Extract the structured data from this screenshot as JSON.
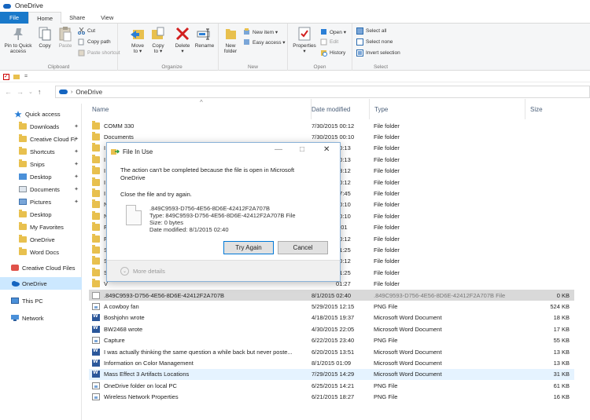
{
  "window": {
    "title": "OneDrive"
  },
  "tabs": [
    {
      "label": "File"
    },
    {
      "label": "Home"
    },
    {
      "label": "Share"
    },
    {
      "label": "View"
    }
  ],
  "ribbon": {
    "clipboard": {
      "label": "Clipboard",
      "pin": "Pin to Quick access",
      "pin_line1": "Pin to Quick",
      "pin_line2": "access",
      "copy": "Copy",
      "paste": "Paste",
      "cut": "Cut",
      "copy_path": "Copy path",
      "paste_shortcut": "Paste shortcut"
    },
    "organize": {
      "label": "Organize",
      "move_to": "Move",
      "move_to2": "to ▾",
      "copy_to": "Copy",
      "copy_to2": "to ▾",
      "delete": "Delete",
      "delete2": "▾",
      "rename": "Rename"
    },
    "new": {
      "label": "New",
      "new_folder1": "New",
      "new_folder2": "folder",
      "new_item": "New item ▾",
      "easy_access": "Easy access ▾"
    },
    "open": {
      "label": "Open",
      "properties": "Properties",
      "properties2": "▾",
      "open": "Open ▾",
      "edit": "Edit",
      "history": "History"
    },
    "select": {
      "label": "Select",
      "select_all": "Select all",
      "select_none": "Select none",
      "invert": "Invert selection"
    }
  },
  "qat": {
    "dropdown": "="
  },
  "address": {
    "back": "←",
    "forward": "→",
    "dropdown": "⌄",
    "up": "↑",
    "separator": "›",
    "path": "OneDrive"
  },
  "leftnav": {
    "items": [
      {
        "label": "Quick access",
        "pinned": false
      },
      {
        "label": "Downloads",
        "pinned": true
      },
      {
        "label": "Creative Cloud Fi",
        "pinned": true
      },
      {
        "label": "Shortcuts",
        "pinned": true
      },
      {
        "label": "Snips",
        "pinned": true
      },
      {
        "label": "Desktop",
        "pinned": true
      },
      {
        "label": "Documents",
        "pinned": true
      },
      {
        "label": "Pictures",
        "pinned": true
      },
      {
        "label": "Desktop",
        "pinned": false
      },
      {
        "label": "My Favorites",
        "pinned": false
      },
      {
        "label": "OneDrive",
        "pinned": false
      },
      {
        "label": "Word Docs",
        "pinned": false
      },
      {
        "label": "Creative Cloud Files",
        "pinned": false
      },
      {
        "label": "OneDrive",
        "pinned": false
      },
      {
        "label": "This PC",
        "pinned": false
      },
      {
        "label": "Network",
        "pinned": false
      }
    ],
    "pin_glyph": "✦"
  },
  "columns": {
    "name": "Name",
    "date": "Date modified",
    "type": "Type",
    "size": "Size",
    "sort_glyph": "^"
  },
  "files": [
    {
      "name": "COMM 330",
      "date": "7/30/2015 00:12",
      "type": "File folder",
      "size": "",
      "icon": "folder"
    },
    {
      "name": "Documents",
      "date": "7/30/2015 00:10",
      "type": "File folder",
      "size": "",
      "icon": "folder"
    },
    {
      "name": "I",
      "date": "00:13",
      "type": "File folder",
      "size": "",
      "icon": "folder"
    },
    {
      "name": "I",
      "date": "00:13",
      "type": "File folder",
      "size": "",
      "icon": "folder"
    },
    {
      "name": "I",
      "date": "03:12",
      "type": "File folder",
      "size": "",
      "icon": "folder"
    },
    {
      "name": "I",
      "date": "00:12",
      "type": "File folder",
      "size": "",
      "icon": "folder"
    },
    {
      "name": "I",
      "date": "17:45",
      "type": "File folder",
      "size": "",
      "icon": "folder"
    },
    {
      "name": "N",
      "date": "00:10",
      "type": "File folder",
      "size": "",
      "icon": "folder"
    },
    {
      "name": "N",
      "date": "00:10",
      "type": "File folder",
      "size": "",
      "icon": "folder"
    },
    {
      "name": "F",
      "date": "6:01",
      "type": "File folder",
      "size": "",
      "icon": "folder"
    },
    {
      "name": "F",
      "date": "00:12",
      "type": "File folder",
      "size": "",
      "icon": "folder"
    },
    {
      "name": "S",
      "date": "01:25",
      "type": "File folder",
      "size": "",
      "icon": "folder"
    },
    {
      "name": "S",
      "date": "00:12",
      "type": "File folder",
      "size": "",
      "icon": "folder"
    },
    {
      "name": "S",
      "date": "01:25",
      "type": "File folder",
      "size": "",
      "icon": "folder"
    },
    {
      "name": "V",
      "date": "01:27",
      "type": "File folder",
      "size": "",
      "icon": "folder"
    },
    {
      "name": ".849C9593-D756-4E56-8D6E-42412F2A707B",
      "date": "8/1/2015 02:40",
      "type": ".849C9593-D756-4E56-8D6E-42412F2A707B File",
      "size": "0 KB",
      "icon": "blank"
    },
    {
      "name": "A cowboy fan",
      "date": "5/29/2015 12:15",
      "type": "PNG File",
      "size": "524 KB",
      "icon": "png"
    },
    {
      "name": "Boshjohn wrote",
      "date": "4/18/2015 19:37",
      "type": "Microsoft Word Document",
      "size": "18 KB",
      "icon": "doc"
    },
    {
      "name": "BW2468 wrote",
      "date": "4/30/2015 22:05",
      "type": "Microsoft Word Document",
      "size": "17 KB",
      "icon": "doc"
    },
    {
      "name": "Capture",
      "date": "6/22/2015 23:40",
      "type": "PNG File",
      "size": "55 KB",
      "icon": "png"
    },
    {
      "name": "I was actually thinking the same question a while back but never poste...",
      "date": "6/20/2015 13:51",
      "type": "Microsoft Word Document",
      "size": "13 KB",
      "icon": "doc"
    },
    {
      "name": "Information on Color Management",
      "date": "8/1/2015 01:09",
      "type": "Microsoft Word Document",
      "size": "13 KB",
      "icon": "doc"
    },
    {
      "name": "Mass Effect 3 Artifacts Locations",
      "date": "7/29/2015 14:29",
      "type": "Microsoft Word Document",
      "size": "31 KB",
      "icon": "doc"
    },
    {
      "name": "OneDrive folder on local PC",
      "date": "6/25/2015 14:21",
      "type": "PNG File",
      "size": "61 KB",
      "icon": "png"
    },
    {
      "name": "Wireless Network Properties",
      "date": "6/21/2015 18:27",
      "type": "PNG File",
      "size": "16 KB",
      "icon": "png"
    }
  ],
  "dialog": {
    "title": "File In Use",
    "minimize": "—",
    "maximize": "□",
    "close": "✕",
    "message_line1": "The action can't be completed because the file is open in Microsoft",
    "message_line2": "OneDrive",
    "instruction": "Close the file and try again.",
    "file_name": ".849C9593-D756-4E56-8D6E-42412F2A707B",
    "file_type": "Type: 849C9593-D756-4E56-8D6E-42412F2A707B File",
    "file_size": "Size: 0 bytes",
    "file_date": "Date modified: 8/1/2015 02:40",
    "try_again": "Try Again",
    "cancel": "Cancel",
    "more_details": "More details",
    "chevron": "⌄"
  },
  "colors": {
    "file_tab": "#1979ca",
    "selection": "#cce8ff",
    "dialog_border": "#8ab2d8",
    "word_icon": "#2b579a",
    "folder_icon": "#e8c04e"
  }
}
